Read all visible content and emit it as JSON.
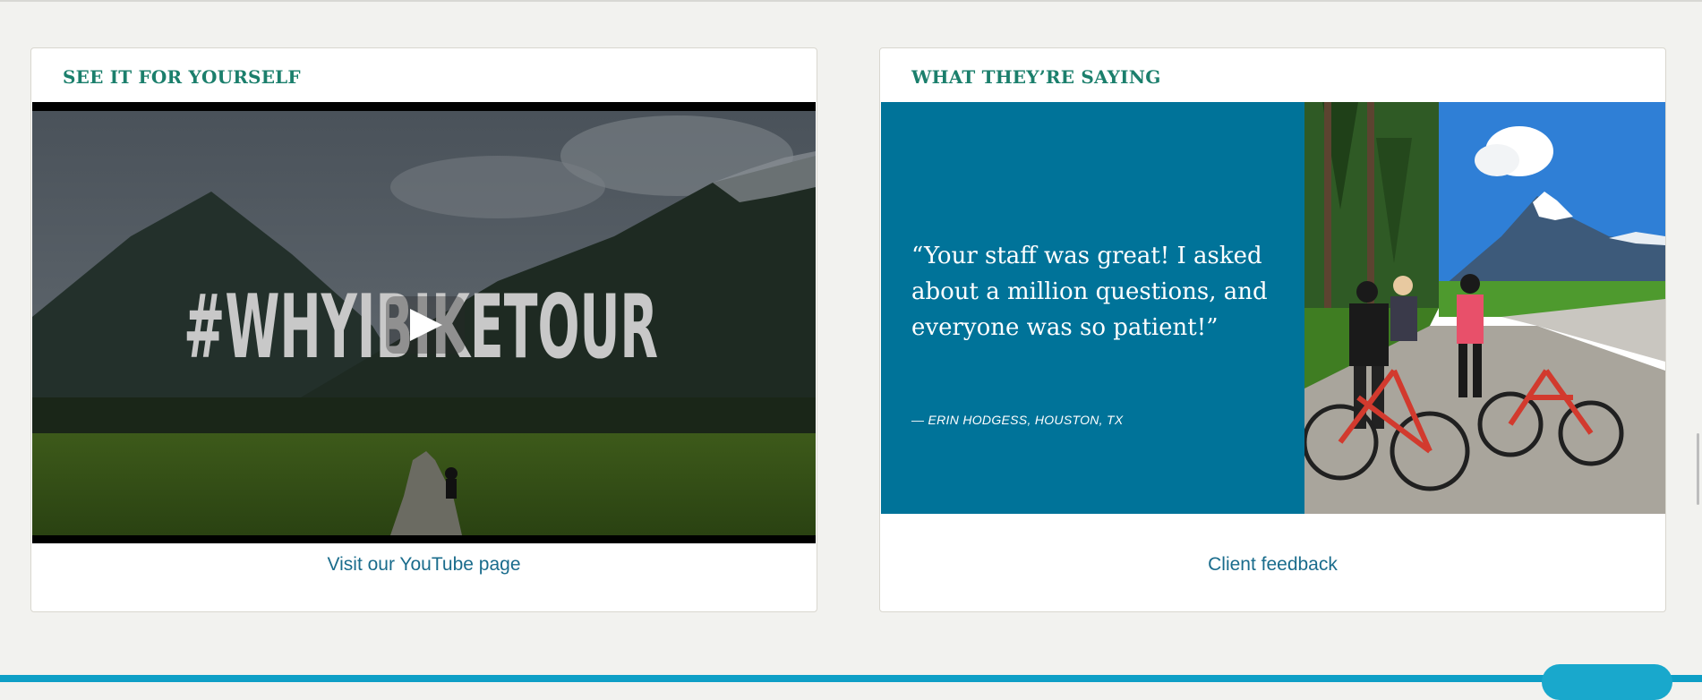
{
  "video_section": {
    "title": "SEE IT FOR YOURSELF",
    "video_overlay_text": "#WHYIBIKETOUR",
    "link_label": "Visit our YouTube page"
  },
  "testimonial_section": {
    "title": "WHAT THEY’RE SAYING",
    "quote": "“Your staff was great! I asked about a million questions, and everyone was so patient!”",
    "author": "— ERIN HODGESS, HOUSTON, TX",
    "link_label": "Client feedback"
  },
  "icons": [
    "play-icon"
  ],
  "colors": {
    "accent_title": "#1b7f6c",
    "link": "#1a6c8c",
    "quote_panel": "#007399",
    "footer_bar": "#0e9fc6"
  }
}
